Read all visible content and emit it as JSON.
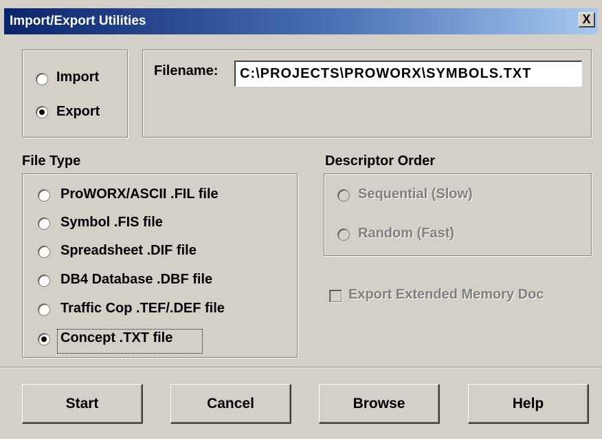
{
  "dialog": {
    "title": "Import/Export Utilities",
    "close_label": "X"
  },
  "mode": {
    "options": [
      {
        "label": "Import",
        "checked": false
      },
      {
        "label": "Export",
        "checked": true
      }
    ]
  },
  "filename": {
    "label": "Filename:",
    "value": "C:\\PROJECTS\\PROWORX\\SYMBOLS.TXT"
  },
  "file_type": {
    "label": "File Type",
    "options": [
      {
        "label": "ProWORX/ASCII .FIL file",
        "checked": false
      },
      {
        "label": "Symbol .FIS file",
        "checked": false
      },
      {
        "label": "Spreadsheet .DIF file",
        "checked": false
      },
      {
        "label": "DB4 Database .DBF file",
        "checked": false
      },
      {
        "label": "Traffic Cop .TEF/.DEF file",
        "checked": false
      },
      {
        "label": "Concept .TXT file",
        "checked": true
      }
    ]
  },
  "descriptor_order": {
    "label": "Descriptor Order",
    "options": [
      {
        "label": "Sequential (Slow)",
        "enabled": false
      },
      {
        "label": "Random (Fast)",
        "enabled": false
      }
    ]
  },
  "extended_memory": {
    "label": "Export Extended Memory Doc",
    "checked": false,
    "enabled": false
  },
  "buttons": {
    "start": "Start",
    "cancel": "Cancel",
    "browse": "Browse",
    "help": "Help"
  }
}
